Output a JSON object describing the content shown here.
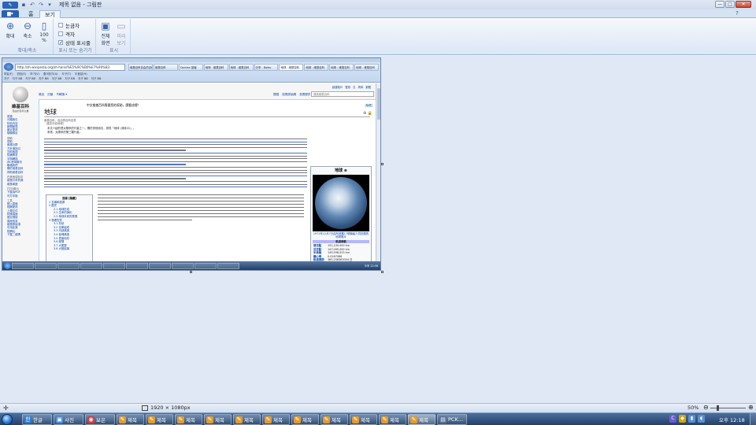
{
  "window": {
    "title": "제목 없음 - 그림판",
    "controls": [
      "—",
      "□",
      "✕"
    ]
  },
  "ribbon": {
    "file_tab": "▆▾",
    "tabs": [
      "홈",
      "보기"
    ],
    "active_tab": "보기",
    "groups": {
      "zoom": {
        "name": "확대/축소",
        "buttons": [
          {
            "label": "확대",
            "icon": "zoom-in-icon",
            "glyph": "⊕"
          },
          {
            "label": "축소",
            "icon": "zoom-out-icon",
            "glyph": "⊖"
          },
          {
            "label": "100 %",
            "icon": "actual-size-icon",
            "glyph": "▯"
          }
        ]
      },
      "show_hide": {
        "name": "표시 또는 숨기기",
        "checkboxes": [
          {
            "label": "눈금자",
            "checked": false
          },
          {
            "label": "격자",
            "checked": false
          },
          {
            "label": "상태 표시줄",
            "checked": true
          }
        ]
      },
      "display": {
        "name": "표시",
        "buttons": [
          {
            "label": "전체 화면",
            "icon": "fullscreen-icon",
            "glyph": "▣"
          },
          {
            "label": "미리 보기",
            "icon": "thumbnail-icon",
            "glyph": "▭"
          }
        ]
      }
    }
  },
  "screenshot": {
    "browser": {
      "address": "http://zh.wikipedia.org/zh-hans/%E5%9C%B0%E7%90%83",
      "tabs": [
        "維基百科自由的百科全書",
        "維基百科",
        "Opinion 讀者",
        "地球 - 維基百科",
        "地球 - 維基百科",
        "分享 - Baidu",
        "地球 - 維基百科",
        "地球 - 維基百科",
        "地球 - 維基百科",
        "地球 - 維基百科"
      ],
      "active_tab": 6,
      "menu": [
        "파일(F)",
        "편집(E)",
        "보기(V)",
        "즐겨찾기(A)",
        "도구(T)",
        "도움말(H)"
      ],
      "favorites": [
        "지구",
        "지구 BB",
        "지구 BB",
        "지구 BB",
        "지구 BB",
        "지구 BB",
        "지구 BB",
        "지구 BB"
      ]
    },
    "wiki": {
      "logo_title": "維基百科",
      "logo_subtitle": "自由的百科全書",
      "top_links": [
        "創建帳戶",
        "登錄",
        "汉",
        "简体",
        "繁體"
      ],
      "tabs_left": [
        "條目",
        "討論",
        "不轉換 ▾"
      ],
      "tabs_right": [
        "閱讀",
        "檢視原始碼",
        "查看歷史"
      ],
      "search_placeholder": "搜索維基百科",
      "notice": "中文維基百科需要您的幫助，請看這裡！",
      "notice_link": "[隐藏]",
      "title": "地球",
      "title_icons": "⊕ 🔒",
      "subtitle": "維基百科，自由的百科全書",
      "subtitle2": "（重定向自地球）",
      "hatnote1": "本文介紹的是太陽系的行星之一。關於其他用法，請見「地球 (消歧义)」。",
      "hatnote2": "參見：太陽系的第三顆行星。",
      "toc_title": "目錄 [隐藏]",
      "toc": [
        {
          "text": "1 名稱和語源",
          "sub": false
        },
        {
          "text": "2 歷史",
          "sub": false
        },
        {
          "text": "2.1 地球形成",
          "sub": true
        },
        {
          "text": "2.2 生命的演化",
          "sub": true
        },
        {
          "text": "2.3 地球未來的發展",
          "sub": true
        },
        {
          "text": "3 物理性質",
          "sub": false
        },
        {
          "text": "3.1 形狀",
          "sub": true
        },
        {
          "text": "3.2 化學組成",
          "sub": true
        },
        {
          "text": "3.3 內部構造",
          "sub": true
        },
        {
          "text": "3.4 板塊構造",
          "sub": true
        },
        {
          "text": "3.5 表面地形",
          "sub": true
        },
        {
          "text": "3.6 磁場",
          "sub": true
        },
        {
          "text": "3.7 大氣層",
          "sub": true
        },
        {
          "text": "3.8 大陸結構",
          "sub": true
        }
      ],
      "infobox": {
        "title": "地球 ⊕",
        "caption": "1972年12月7日由阿波羅17號機組人員拍攝的地球照片",
        "section": "軌道參數",
        "rows": [
          {
            "k": "遠日點",
            "v": "152,100,000 km"
          },
          {
            "k": "近日點",
            "v": "147,095,000 km"
          },
          {
            "k": "半長軸",
            "v": "149,598,023 km"
          },
          {
            "k": "離心率",
            "v": "0.0167086"
          },
          {
            "k": "軌道週期",
            "v": "365.256363004 日"
          }
        ]
      },
      "sidebar": [
        {
          "head": false,
          "text": "首頁"
        },
        {
          "head": false,
          "text": "分類索引"
        },
        {
          "head": false,
          "text": "特色內容"
        },
        {
          "head": false,
          "text": "新聞動態"
        },
        {
          "head": false,
          "text": "最近更改"
        },
        {
          "head": false,
          "text": "隨機條目"
        },
        {
          "head": true,
          "text": "幫助"
        },
        {
          "head": false,
          "text": "幫助"
        },
        {
          "head": false,
          "text": "維基社群"
        },
        {
          "head": false,
          "text": "方針與指引"
        },
        {
          "head": false,
          "text": "互助客棧"
        },
        {
          "head": false,
          "text": "知識問答"
        },
        {
          "head": false,
          "text": "字詞轉換"
        },
        {
          "head": false,
          "text": "IRC即時聊天"
        },
        {
          "head": false,
          "text": "聯絡我們"
        },
        {
          "head": false,
          "text": "關於維基百科"
        },
        {
          "head": false,
          "text": "資助維基百科"
        },
        {
          "head": true,
          "text": "在其他項目中"
        },
        {
          "head": false,
          "text": "維基共享資源"
        },
        {
          "head": false,
          "text": "維基導遊"
        },
        {
          "head": true,
          "text": "打印/導出"
        },
        {
          "head": false,
          "text": "下載為PDF"
        },
        {
          "head": false,
          "text": "可打印版"
        },
        {
          "head": true,
          "text": "工具"
        },
        {
          "head": false,
          "text": "鏈入頁面"
        },
        {
          "head": false,
          "text": "相關更改"
        },
        {
          "head": false,
          "text": "上傳文件"
        },
        {
          "head": false,
          "text": "特殊頁面"
        },
        {
          "head": false,
          "text": "固定鏈接"
        },
        {
          "head": false,
          "text": "頁面信息"
        },
        {
          "head": false,
          "text": "維基數據項"
        },
        {
          "head": false,
          "text": "引用此頁"
        },
        {
          "head": false,
          "text": "短網址"
        },
        {
          "head": false,
          "text": "下載二維碼"
        }
      ]
    },
    "inner_clock": "오후 12:06"
  },
  "statusbar": {
    "image_size": "1920 × 1080px",
    "zoom": "50%",
    "zoom_level": 0.17
  },
  "taskbar": {
    "items": [
      {
        "label": "한글",
        "icon": "hwp-icon",
        "glyph": "한",
        "color": "#2f7bd1"
      },
      {
        "label": "사진",
        "icon": "photo-icon",
        "glyph": "▣",
        "color": "#4a8bd6"
      },
      {
        "label": "보은",
        "icon": "chrome-icon",
        "glyph": "◉",
        "color": "#d23c3c"
      },
      {
        "label": "제목",
        "icon": "paint-icon",
        "glyph": "✎",
        "color": "#e39b2c"
      },
      {
        "label": "제목",
        "icon": "paint-icon",
        "glyph": "✎",
        "color": "#e39b2c"
      },
      {
        "label": "제목",
        "icon": "paint-icon",
        "glyph": "✎",
        "color": "#e39b2c"
      },
      {
        "label": "제목",
        "icon": "paint-icon",
        "glyph": "✎",
        "color": "#e39b2c"
      },
      {
        "label": "제목",
        "icon": "paint-icon",
        "glyph": "✎",
        "color": "#e39b2c"
      },
      {
        "label": "제목",
        "icon": "paint-icon",
        "glyph": "✎",
        "color": "#e39b2c"
      },
      {
        "label": "제목",
        "icon": "paint-icon",
        "glyph": "✎",
        "color": "#e39b2c"
      },
      {
        "label": "제목",
        "icon": "paint-icon",
        "glyph": "✎",
        "color": "#e39b2c"
      },
      {
        "label": "제목",
        "icon": "paint-icon",
        "glyph": "✎",
        "color": "#e39b2c"
      },
      {
        "label": "제목",
        "icon": "paint-icon",
        "glyph": "✎",
        "color": "#e39b2c"
      },
      {
        "label": "제목",
        "icon": "paint-icon",
        "glyph": "✎",
        "color": "#e39b2c"
      },
      {
        "label": "PCK...",
        "icon": "app-icon",
        "glyph": "▤",
        "color": "#5a6f8f"
      }
    ],
    "active_index": 13,
    "tray_icons": [
      {
        "icon": "c-icon",
        "glyph": "C",
        "color": "#6b5bd1"
      },
      {
        "icon": "shield-icon",
        "glyph": "◆",
        "color": "#d9a400"
      },
      {
        "icon": "network-icon",
        "glyph": "▮",
        "color": "#5b8fd1"
      },
      {
        "icon": "volume-icon",
        "glyph": "◖",
        "color": "#5b8fd1"
      }
    ],
    "clock": "오후 12:18"
  }
}
